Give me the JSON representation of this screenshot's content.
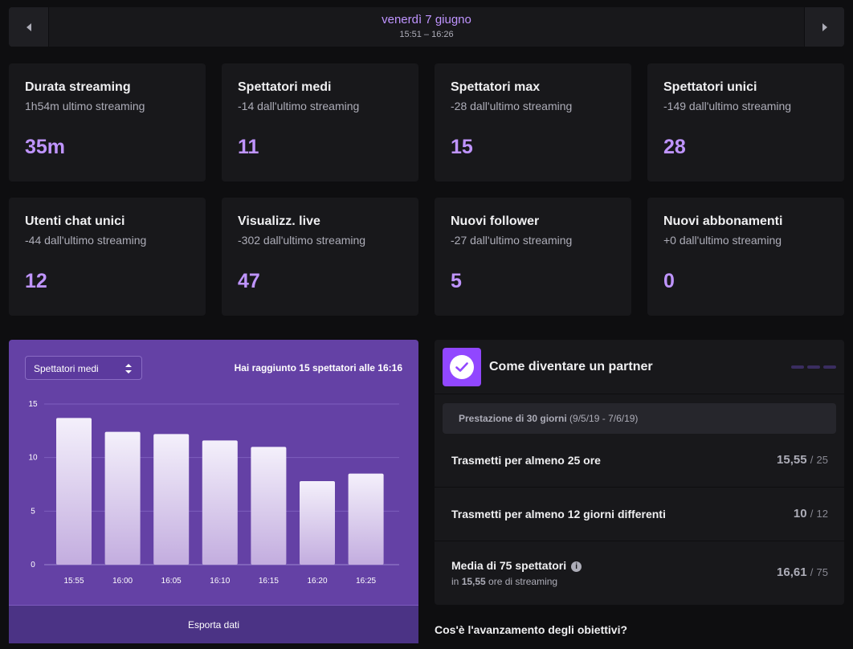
{
  "datebar": {
    "title": "venerdì 7 giugno",
    "range": "15:51 – 16:26"
  },
  "stats": [
    {
      "title": "Durata streaming",
      "sub": "1h54m ultimo streaming",
      "value": "35m"
    },
    {
      "title": "Spettatori medi",
      "sub": "-14 dall'ultimo streaming",
      "value": "11"
    },
    {
      "title": "Spettatori max",
      "sub": "-28 dall'ultimo streaming",
      "value": "15"
    },
    {
      "title": "Spettatori unici",
      "sub": "-149 dall'ultimo streaming",
      "value": "28"
    },
    {
      "title": "Utenti chat unici",
      "sub": "-44 dall'ultimo streaming",
      "value": "12"
    },
    {
      "title": "Visualizz. live",
      "sub": "-302 dall'ultimo streaming",
      "value": "47"
    },
    {
      "title": "Nuovi follower",
      "sub": "-27 dall'ultimo streaming",
      "value": "5"
    },
    {
      "title": "Nuovi abbonamenti",
      "sub": "+0 dall'ultimo streaming",
      "value": "0"
    }
  ],
  "chart_panel": {
    "select_value": "Spettatori medi",
    "note_prefix": "Hai raggiunto ",
    "note_bold": "15 spettatori",
    "note_suffix": " alle 16:16",
    "export_label": "Esporta dati"
  },
  "chart_data": {
    "type": "bar",
    "categories": [
      "15:55",
      "16:00",
      "16:05",
      "16:10",
      "16:15",
      "16:20",
      "16:25"
    ],
    "values": [
      13.7,
      12.4,
      12.2,
      11.6,
      11.0,
      7.8,
      8.5
    ],
    "yticks": [
      0,
      5,
      10,
      15
    ],
    "ylim": [
      0,
      15
    ],
    "grid": true,
    "title": "",
    "xlabel": "",
    "ylabel": ""
  },
  "partner": {
    "title": "Come diventare un partner",
    "period_label": "Prestazione di 30 giorni",
    "period_dates": "(9/5/19 - 7/6/19)",
    "requirements": [
      {
        "label": "Trasmetti per almeno 25 ore",
        "sub": "",
        "current": "15,55",
        "total": "25"
      },
      {
        "label": "Trasmetti per almeno 12 giorni differenti",
        "sub": "",
        "current": "10",
        "total": "12"
      },
      {
        "label": "Media di 75 spettatori",
        "sub_prefix": "in ",
        "sub_bold": "15,55",
        "sub_suffix": " ore di streaming",
        "current": "16,61",
        "total": "75"
      }
    ],
    "separator": "/",
    "info_glyph": "i"
  },
  "question": "Cos'è l'avanzamento degli obiettivi?",
  "colors": {
    "accent": "#bf94ff",
    "chart_bg": "#6441a5",
    "card_bg": "#18181b",
    "page_bg": "#0e0e10"
  }
}
